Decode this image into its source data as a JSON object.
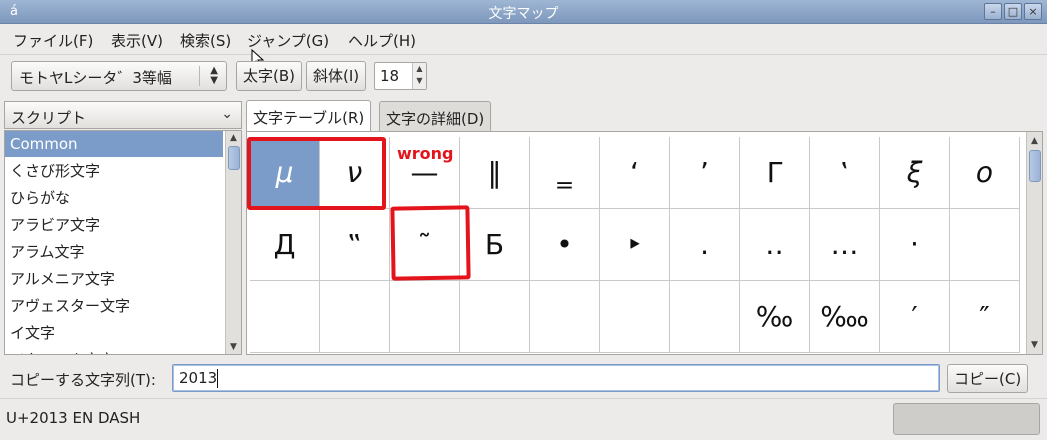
{
  "window": {
    "title": "文字マップ",
    "app_icon": "á",
    "controls": {
      "minimize": "–",
      "maximize": "□",
      "close": "×"
    }
  },
  "menu": [
    {
      "label": "ファイル(F)"
    },
    {
      "label": "表示(V)"
    },
    {
      "label": "検索(S)"
    },
    {
      "label": "ジャンプ(G)"
    },
    {
      "label": "ヘルプ(H)"
    }
  ],
  "toolbar": {
    "font_name": "モトヤLシータ゛3等幅",
    "bold_label": "太字(B)",
    "italic_label": "斜体(I)",
    "font_size": "18"
  },
  "script_panel": {
    "header": "スクリプト",
    "items": [
      {
        "label": "Common",
        "selected": true
      },
      {
        "label": "くさび形文字"
      },
      {
        "label": "ひらがな"
      },
      {
        "label": "アラビア文字"
      },
      {
        "label": "アラム文字"
      },
      {
        "label": "アルメニア文字"
      },
      {
        "label": "アヴェスター文字"
      },
      {
        "label": "イ文字"
      },
      {
        "label": "イタリック文字"
      }
    ]
  },
  "tabs": [
    {
      "label": "文字テーブル(R)",
      "active": true
    },
    {
      "label": "文字の詳細(D)"
    }
  ],
  "char_table": {
    "rows": [
      [
        "μ",
        "ν",
        "—",
        "‖",
        "‗",
        "‘",
        "’",
        "Γ",
        "‛",
        "ξ",
        "ο"
      ],
      [
        "Д",
        "‟",
        "˜",
        "Б",
        "•",
        "‣",
        "․",
        "‥",
        "…",
        "‧",
        ""
      ],
      [
        "",
        "",
        "",
        "",
        "",
        "",
        "",
        "‰",
        "‱",
        "′",
        "″"
      ]
    ]
  },
  "annotation": {
    "label": "wrong",
    "color": "#e3141b"
  },
  "copy": {
    "label": "コピーする文字列(T):",
    "value": "2013",
    "button": "コピー(C)"
  },
  "status": {
    "text": "U+2013 EN DASH"
  },
  "colors": {
    "selection": "#7b9cc9",
    "titlebar": "#8aa3c6"
  }
}
